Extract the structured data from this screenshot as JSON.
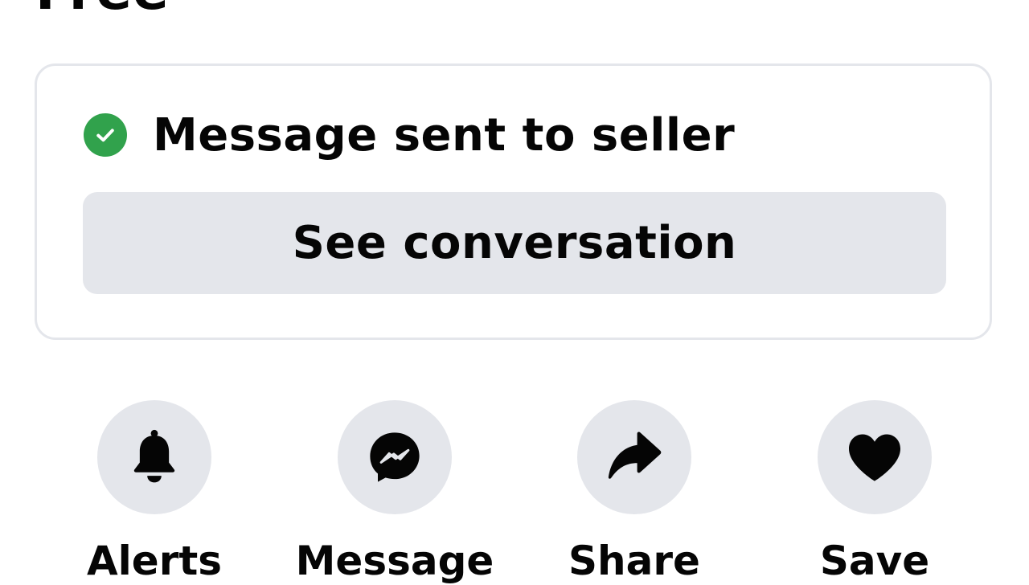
{
  "listing": {
    "price": "Free"
  },
  "confirmation": {
    "status_text": "Message sent to seller",
    "status_color": "#31a24c",
    "see_conversation_label": "See conversation"
  },
  "actions": [
    {
      "label": "Alerts",
      "icon": "bell-icon"
    },
    {
      "label": "Message",
      "icon": "messenger-icon"
    },
    {
      "label": "Share",
      "icon": "share-arrow-icon"
    },
    {
      "label": "Save",
      "icon": "heart-icon"
    }
  ]
}
